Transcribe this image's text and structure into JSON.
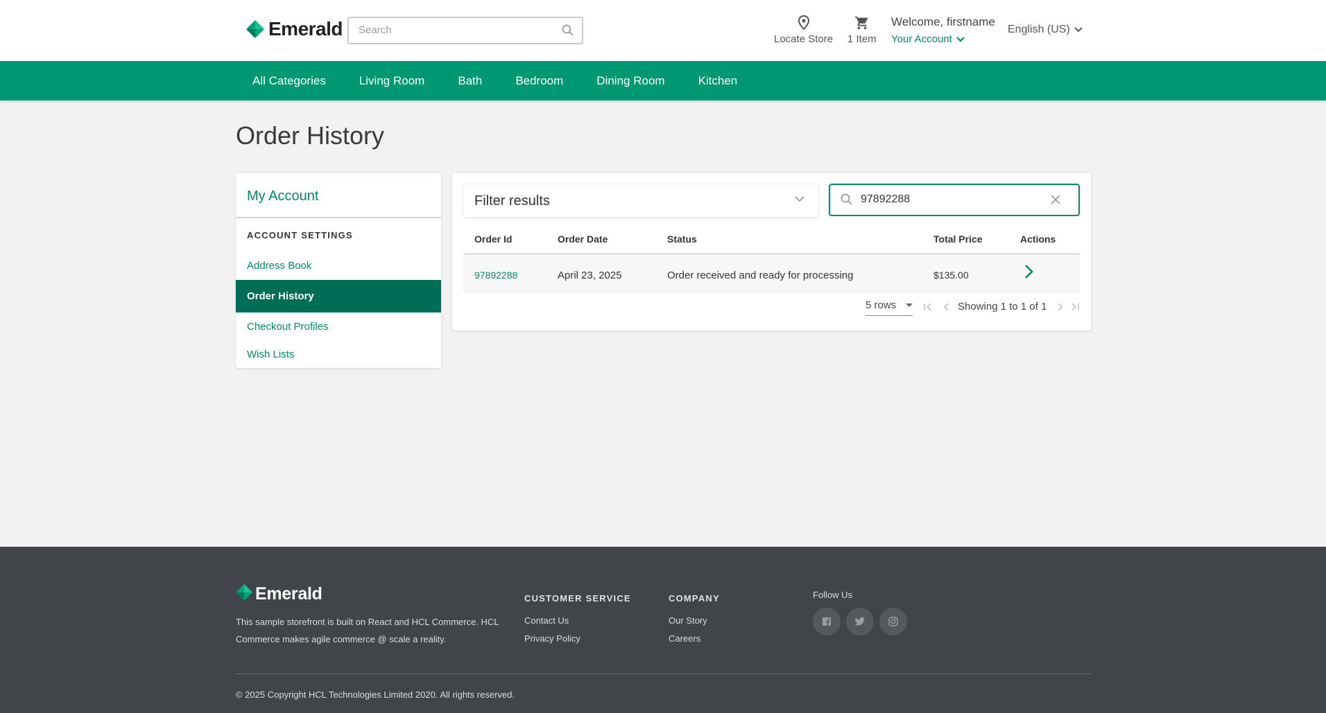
{
  "header": {
    "brand": "Emerald",
    "search_placeholder": "Search",
    "locate_store": "Locate Store",
    "cart_count": "1 Item",
    "welcome": "Welcome, firstname",
    "your_account": "Your Account",
    "language": "English (US)"
  },
  "nav": {
    "items": [
      "All Categories",
      "Living Room",
      "Bath",
      "Bedroom",
      "Dining Room",
      "Kitchen"
    ]
  },
  "page": {
    "title": "Order History"
  },
  "sidebar": {
    "title": "My Account",
    "section": "ACCOUNT SETTINGS",
    "items": [
      {
        "label": "Address Book"
      },
      {
        "label": "Order History"
      },
      {
        "label": "Checkout Profiles"
      },
      {
        "label": "Wish Lists"
      }
    ]
  },
  "orders": {
    "filter_label": "Filter results",
    "search_value": "97892288",
    "columns": [
      "Order Id",
      "Order Date",
      "Status",
      "Total Price",
      "Actions"
    ],
    "rows": [
      {
        "order_id": "97892288",
        "date": "April 23, 2025",
        "status": "Order received and ready for processing",
        "total": "$135.00"
      }
    ],
    "rows_per_page": "5 rows",
    "showing": "Showing 1 to 1 of 1"
  },
  "footer": {
    "brand": "Emerald",
    "description": "This sample storefront is built on React and HCL Commerce. HCL Commerce makes agile commerce @ scale a reality.",
    "customer_service": {
      "title": "CUSTOMER SERVICE",
      "links": [
        "Contact Us",
        "Privacy Policy"
      ]
    },
    "company": {
      "title": "COMPANY",
      "links": [
        "Our Story",
        "Careers"
      ]
    },
    "follow_us": "Follow Us",
    "copyright": "© 2025 Copyright HCL Technologies Limited 2020. All rights reserved."
  },
  "colors": {
    "brand_green": "#009872",
    "dark_green": "#006d57",
    "link_green": "#008a66",
    "footer_bg": "#414549"
  }
}
